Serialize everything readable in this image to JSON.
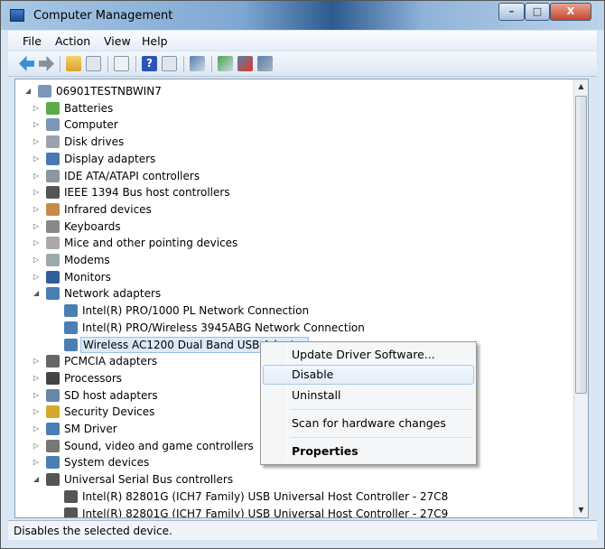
{
  "window": {
    "title": "Computer Management",
    "icon": "computer-management-icon",
    "controls": [
      "minimize",
      "maximize",
      "close"
    ]
  },
  "menubar": [
    "File",
    "Action",
    "View",
    "Help"
  ],
  "toolbar": [
    "back-arrow-icon",
    "forward-arrow-icon",
    "up-folder-icon",
    "show-hide-console-tree-icon",
    "properties-icon",
    "help-icon",
    "show-action-pane-icon",
    "scan-hardware-icon",
    "update-driver-icon",
    "disable-device-icon",
    "uninstall-device-icon"
  ],
  "tree": [
    {
      "label": "06901TESTNBWIN7",
      "level": 0,
      "expanded": true,
      "icon": "computer-icon"
    },
    {
      "label": "Batteries",
      "level": 1,
      "icon": "battery-icon"
    },
    {
      "label": "Computer",
      "level": 1,
      "icon": "computer-icon"
    },
    {
      "label": "Disk drives",
      "level": 1,
      "icon": "disk-drive-icon"
    },
    {
      "label": "Display adapters",
      "level": 1,
      "icon": "display-adapter-icon"
    },
    {
      "label": "IDE ATA/ATAPI controllers",
      "level": 1,
      "icon": "ide-controller-icon"
    },
    {
      "label": "IEEE 1394 Bus host controllers",
      "level": 1,
      "icon": "ieee1394-icon"
    },
    {
      "label": "Infrared devices",
      "level": 1,
      "icon": "infrared-icon"
    },
    {
      "label": "Keyboards",
      "level": 1,
      "icon": "keyboard-icon"
    },
    {
      "label": "Mice and other pointing devices",
      "level": 1,
      "icon": "mouse-icon"
    },
    {
      "label": "Modems",
      "level": 1,
      "icon": "modem-icon"
    },
    {
      "label": "Monitors",
      "level": 1,
      "icon": "monitor-icon"
    },
    {
      "label": "Network adapters",
      "level": 1,
      "expanded": true,
      "icon": "network-adapter-icon"
    },
    {
      "label": "Intel(R) PRO/1000 PL Network Connection",
      "level": 2,
      "icon": "network-adapter-icon"
    },
    {
      "label": "Intel(R) PRO/Wireless 3945ABG Network Connection",
      "level": 2,
      "icon": "network-adapter-icon"
    },
    {
      "label": "Wireless AC1200 Dual Band USB Adapter",
      "level": 2,
      "selected": true,
      "icon": "network-adapter-icon"
    },
    {
      "label": "PCMCIA adapters",
      "level": 1,
      "icon": "pcmcia-icon"
    },
    {
      "label": "Processors",
      "level": 1,
      "icon": "processor-icon"
    },
    {
      "label": "SD host adapters",
      "level": 1,
      "icon": "sd-adapter-icon"
    },
    {
      "label": "Security Devices",
      "level": 1,
      "icon": "security-key-icon"
    },
    {
      "label": "SM Driver",
      "level": 1,
      "icon": "sm-driver-icon"
    },
    {
      "label": "Sound, video and game controllers",
      "level": 1,
      "icon": "speaker-icon"
    },
    {
      "label": "System devices",
      "level": 1,
      "icon": "system-device-icon"
    },
    {
      "label": "Universal Serial Bus controllers",
      "level": 1,
      "expanded": true,
      "icon": "usb-icon"
    },
    {
      "label": "Intel(R) 82801G (ICH7 Family) USB Universal Host Controller - 27C8",
      "level": 2,
      "icon": "usb-icon"
    },
    {
      "label": "Intel(R) 82801G (ICH7 Family) USB Universal Host Controller - 27C9",
      "level": 2,
      "icon": "usb-icon"
    }
  ],
  "context_menu": {
    "items": [
      {
        "label": "Update Driver Software..."
      },
      {
        "label": "Disable",
        "highlighted": true
      },
      {
        "label": "Uninstall"
      },
      {
        "label": "Scan for hardware changes"
      },
      {
        "label": "Properties",
        "bold": true
      }
    ]
  },
  "status": "Disables the selected device."
}
